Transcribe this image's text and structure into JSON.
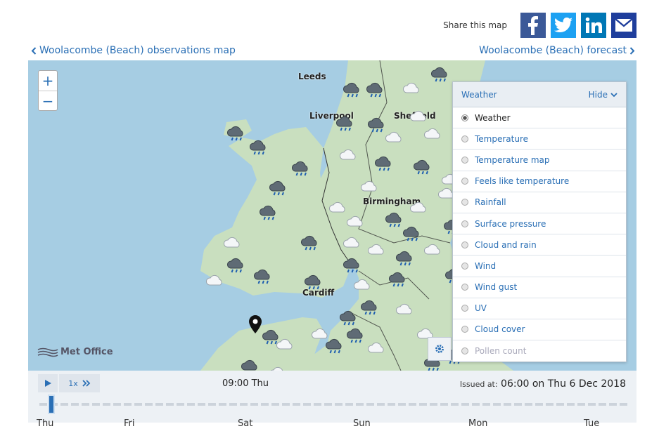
{
  "share": {
    "label": "Share this map",
    "buttons": [
      {
        "name": "facebook",
        "glyph": "f"
      },
      {
        "name": "twitter",
        "glyph": "t"
      },
      {
        "name": "linkedin",
        "glyph": "in"
      },
      {
        "name": "email",
        "glyph": "✉"
      }
    ]
  },
  "nav": {
    "left_label": "Woolacombe (Beach) observations map",
    "right_label": "Woolacombe (Beach) forecast"
  },
  "map": {
    "cities": [
      "Leeds",
      "Liverpool",
      "Sheffield",
      "Birmingham",
      "Cardiff"
    ],
    "brand": "Met Office",
    "zoom_in": "+",
    "zoom_out": "−"
  },
  "layers": {
    "title": "Weather",
    "hide_label": "Hide",
    "selected": "Weather",
    "items": [
      "Weather",
      "Temperature",
      "Temperature map",
      "Feels like temperature",
      "Rainfall",
      "Surface pressure",
      "Cloud and rain",
      "Wind",
      "Wind gust",
      "UV",
      "Cloud cover",
      "Pollen count"
    ],
    "disabled": "Pollen count"
  },
  "timeline": {
    "speed": "1x",
    "current_time": "09:00 Thu",
    "issued_label": "Issued at:",
    "issued_value": "06:00 on Thu 6 Dec 2018",
    "progress": 0.02,
    "days": [
      "Thu",
      "Fri",
      "Sat",
      "Sun",
      "Mon",
      "Tue"
    ]
  },
  "colors": {
    "link": "#2a6fb5",
    "sea": "#a6cde3",
    "land": "#c9dfbf"
  }
}
